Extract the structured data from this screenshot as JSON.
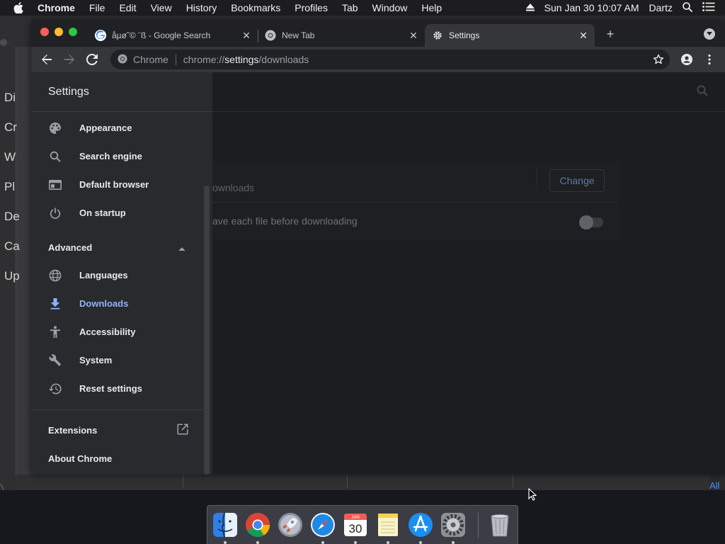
{
  "menubar": {
    "app_name": "Chrome",
    "items": [
      "File",
      "Edit",
      "View",
      "History",
      "Bookmarks",
      "Profiles",
      "Tab",
      "Window",
      "Help"
    ],
    "datetime": "Sun Jan 30  10:07 AM",
    "user": "Dartz"
  },
  "background_window": {
    "letters": [
      "Di",
      "Cr",
      "W",
      "Pl",
      "De",
      "Ca",
      "Up"
    ],
    "fragment": "All"
  },
  "tabs": [
    {
      "title": "åµø˜© ¨ß - Google Search",
      "favicon": "google-g-icon"
    },
    {
      "title": "New Tab",
      "favicon": "chrome-icon"
    },
    {
      "title": "Settings",
      "favicon": "gear-icon",
      "active": true
    }
  ],
  "omnibox": {
    "chip": "Chrome",
    "url_prefix": "chrome://",
    "url_host": "settings",
    "url_path": "/downloads"
  },
  "drawer": {
    "title": "Settings",
    "items": [
      {
        "label": "Appearance",
        "icon": "palette-icon"
      },
      {
        "label": "Search engine",
        "icon": "search-icon"
      },
      {
        "label": "Default browser",
        "icon": "browser-window-icon"
      },
      {
        "label": "On startup",
        "icon": "power-icon"
      }
    ],
    "advanced_label": "Advanced",
    "advanced_items": [
      {
        "label": "Languages",
        "icon": "globe-icon"
      },
      {
        "label": "Downloads",
        "icon": "download-icon",
        "selected": true
      },
      {
        "label": "Accessibility",
        "icon": "accessibility-icon"
      },
      {
        "label": "System",
        "icon": "wrench-icon"
      },
      {
        "label": "Reset settings",
        "icon": "history-icon"
      }
    ],
    "extensions_label": "Extensions",
    "about_label": "About Chrome"
  },
  "downloads": {
    "location_fragment": "ownloads",
    "change_button": "Change",
    "ask_fragment": "ave each file before downloading",
    "ask_enabled": false
  },
  "dock": {
    "apps": [
      "finder-icon",
      "chrome-icon",
      "launchpad-icon",
      "safari-icon",
      "calendar-icon",
      "notes-icon",
      "app-store-icon",
      "system-preferences-icon",
      "trash-icon"
    ],
    "calendar_month": "JAN",
    "calendar_day": "30"
  },
  "colors": {
    "accent": "#8ab4f8",
    "page_bg": "#1c1d20",
    "drawer_bg": "#292a2d"
  }
}
